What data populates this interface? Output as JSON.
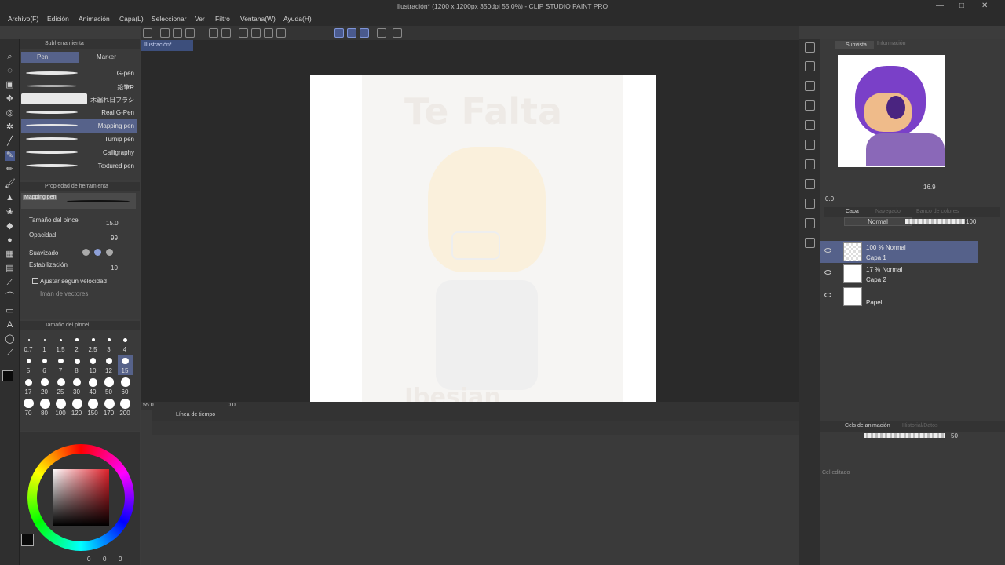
{
  "window": {
    "title": "Ilustración* (1200 x 1200px 350dpi 55.0%) - CLIP STUDIO PAINT PRO",
    "controls": [
      "—",
      "□",
      "✕"
    ]
  },
  "menu": [
    "Archivo(F)",
    "Edición",
    "Animación",
    "Capa(L)",
    "Seleccionar",
    "Ver",
    "Filtro",
    "Ventana(W)",
    "Ayuda(H)"
  ],
  "document_tab": "Ilustración*",
  "subtool_panel": {
    "title": "Subherramienta",
    "tabs": [
      "Pen",
      "Marker"
    ],
    "brushes": [
      "G-pen",
      "鉛筆R",
      "木漏れ日ブラシ",
      "Real G-Pen",
      "Mapping pen",
      "Turnip pen",
      "Calligraphy",
      "Textured pen"
    ],
    "selected_brush": "Mapping pen"
  },
  "tool_property": {
    "title": "Propiedad de herramienta",
    "preset_name": "Mapping pen",
    "brush_size_label": "Tamaño del pincel",
    "brush_size_value": "15.0",
    "opacity_label": "Opacidad",
    "opacity_value": "99",
    "smoothing_label": "Suavizado",
    "stabilization_label": "Estabilización",
    "stabilization_value": "10",
    "speed_adjust_label": "Ajustar según velocidad",
    "vector_magnet_label": "Imán de vectores"
  },
  "brush_sizes": {
    "title": "Tamaño del pincel",
    "values": [
      "0.7",
      "1",
      "1.5",
      "2",
      "2.5",
      "3",
      "4",
      "5",
      "6",
      "7",
      "8",
      "10",
      "12",
      "15",
      "17",
      "20",
      "25",
      "30",
      "40",
      "50",
      "60",
      "70",
      "80",
      "100",
      "120",
      "150",
      "170",
      "200"
    ],
    "selected": "15"
  },
  "color": {
    "main": "#0a0a0a",
    "sub": "#ffffff",
    "rgb_readout": [
      "0",
      "0",
      "0"
    ]
  },
  "canvas": {
    "zoom_value": "55.0",
    "rotation_value": "0.0",
    "artwork_text": "Te Falta",
    "artwork_text_bottom": "Ibesian"
  },
  "timeline": {
    "title": "Línea de tiempo"
  },
  "subview": {
    "tabs": [
      "Subvista",
      "Información"
    ],
    "zoom_value": "16.9",
    "rotation_value": "0.0"
  },
  "layers": {
    "tabs": [
      "Capa",
      "Navegador",
      "Banco de colores"
    ],
    "blend_mode": "Normal",
    "opacity": "100",
    "items": [
      {
        "info": "100 % Normal",
        "name": "Capa 1",
        "selected": true
      },
      {
        "info": "17 % Normal",
        "name": "Capa 2",
        "selected": false
      },
      {
        "info": "",
        "name": "Papel",
        "selected": false
      }
    ]
  },
  "animation_cels": {
    "tabs": [
      "Cels de animación",
      "Historial/Datos"
    ],
    "opacity_value": "50",
    "footer_text": "Cel editado"
  }
}
